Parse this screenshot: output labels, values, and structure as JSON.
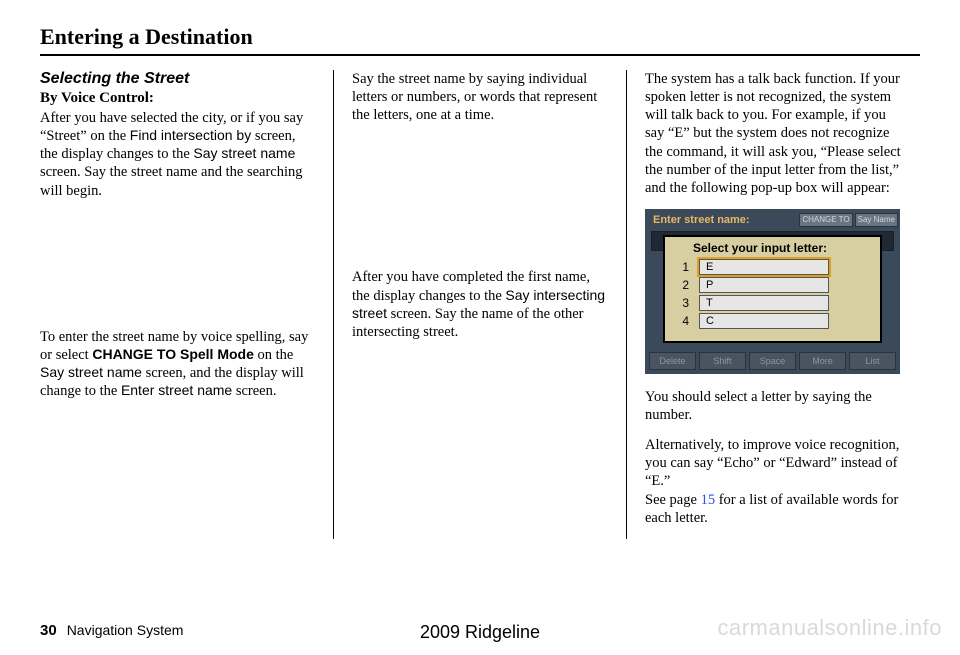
{
  "page_title": "Entering a Destination",
  "col1": {
    "section_title": "Selecting the Street",
    "subhead": "By Voice Control:",
    "p1_a": "After you have selected the city, or if you say “Street” on the ",
    "p1_b": "Find intersection by",
    "p1_c": " screen, the display changes to the ",
    "p1_d": "Say street name",
    "p1_e": " screen. Say the street name and the searching will begin.",
    "p2_a": "To enter the street name by voice spelling, say or select ",
    "p2_b": "CHANGE TO Spell Mode",
    "p2_c": " on the ",
    "p2_d": "Say street name",
    "p2_e": " screen, and the display will change to the ",
    "p2_f": "Enter street name",
    "p2_g": " screen."
  },
  "col2": {
    "p1": "Say the street name by saying individual letters or numbers, or words that represent the letters, one at a time.",
    "p2_a": "After you have completed the first name, the display changes to the ",
    "p2_b": "Say intersecting street",
    "p2_c": " screen. Say the name of the other intersecting street."
  },
  "col3": {
    "p1": "The system has a talk back function. If your spoken letter is not recognized, the system will talk back to you. For example, if you say “E” but the system does not recognize the command, it will ask you, “Please select the number of the input letter from the list,” and the following pop-up box will appear:",
    "nav": {
      "screen_label": "Enter street name:",
      "btn_change": "CHANGE TO",
      "btn_sayname": "Say Name",
      "popup_title": "Select your input letter:",
      "options": [
        {
          "num": "1",
          "letter": "E"
        },
        {
          "num": "2",
          "letter": "P"
        },
        {
          "num": "3",
          "letter": "T"
        },
        {
          "num": "4",
          "letter": "C"
        }
      ],
      "bottom": [
        "Delete",
        "Shift",
        "Space",
        "More",
        "List"
      ]
    },
    "p2": "You should select a letter by saying the number.",
    "p3_a": "Alternatively, to improve voice recognition, you can say “Echo” or “Edward” instead of “E.”",
    "p3_b": "See page ",
    "p3_link": "15",
    "p3_c": " for a list of available words for each letter."
  },
  "footer": {
    "page": "30",
    "label": "Navigation System",
    "center": "2009  Ridgeline"
  },
  "watermark": "carmanualsonline.info"
}
